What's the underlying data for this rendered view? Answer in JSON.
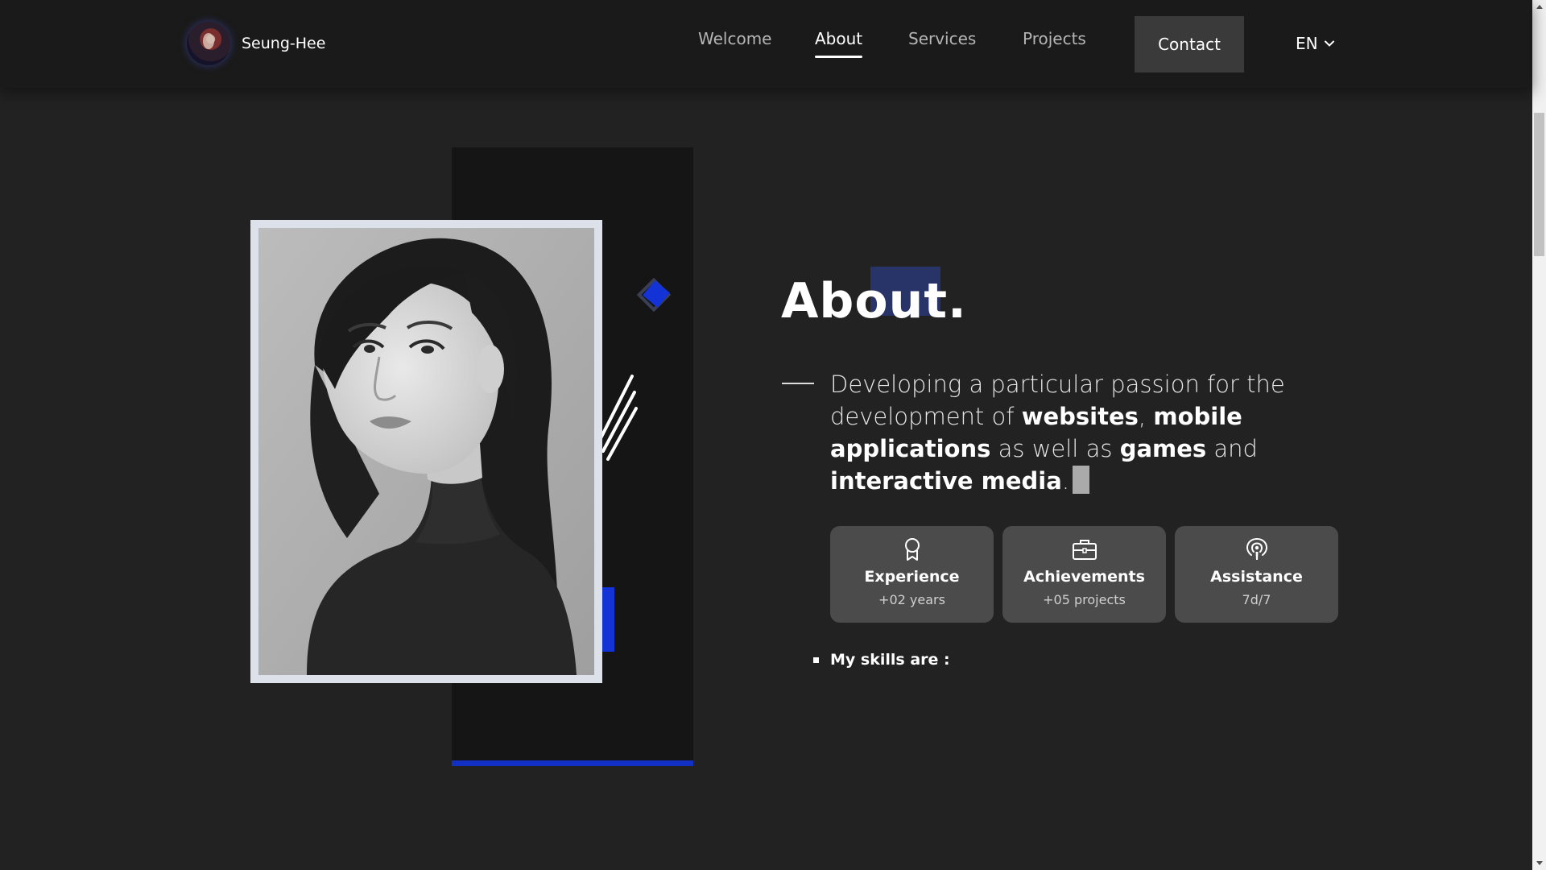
{
  "header": {
    "brand_name": "Seung-Hee",
    "nav": [
      {
        "label": "Welcome",
        "active": false
      },
      {
        "label": "About",
        "active": true
      },
      {
        "label": "Services",
        "active": false
      },
      {
        "label": "Projects",
        "active": false
      }
    ],
    "contact_label": "Contact",
    "language": "EN"
  },
  "about": {
    "title": "About.",
    "intro": {
      "part1": "Developing a particular passion for the development of ",
      "bold1": "websites",
      "part2": ", ",
      "bold2": "mobile applications",
      "part3": " as well as ",
      "bold3": "games",
      "part4": " and ",
      "bold4": "interactive media",
      "part5": "."
    },
    "cards": [
      {
        "icon": "award-ribbon-icon",
        "title": "Experience",
        "subtitle": "+02 years"
      },
      {
        "icon": "briefcase-icon",
        "title": "Achievements",
        "subtitle": "+05 projects"
      },
      {
        "icon": "podcast-icon",
        "title": "Assistance",
        "subtitle": "7d/7"
      }
    ],
    "skills_label": "My skills are :"
  },
  "colors": {
    "background": "#222222",
    "header": "#1a1a1a",
    "accent_blue": "#1333d6",
    "card": "#4b4b4b"
  }
}
